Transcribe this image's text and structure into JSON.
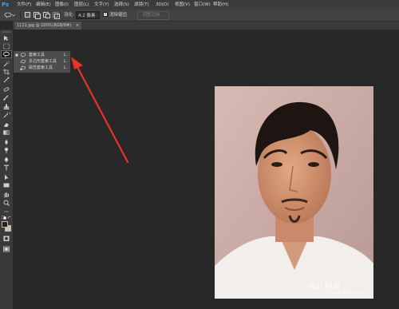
{
  "app": {
    "logo": "Ps"
  },
  "menus": [
    "文件(F)",
    "编辑(E)",
    "图像(I)",
    "图层(L)",
    "文字(Y)",
    "选择(S)",
    "滤镜(T)",
    "3D(D)",
    "视图(V)",
    "窗口(W)",
    "帮助(H)"
  ],
  "options": {
    "feather_label": "羽化:",
    "feather_value": "4.2 像素",
    "antialias_label": "消除锯齿",
    "antialias_checked": true,
    "refine_edge_label": "调整边缘..."
  },
  "document_tab": {
    "title": "1111.jpg @ 100%(RGB/8#)",
    "close": "×"
  },
  "flyout": {
    "items": [
      {
        "label": "套索工具",
        "shortcut": "L",
        "selected": true
      },
      {
        "label": "多边形套索工具",
        "shortcut": "L",
        "selected": false
      },
      {
        "label": "磁性套索工具",
        "shortcut": "L",
        "selected": false
      }
    ]
  },
  "watermark": {
    "text": "Bai 经验",
    "sub": "jingyan.baidu.com"
  },
  "colors": {
    "accent": "#31a8ff",
    "arrow": "#e8322a",
    "foreground": "#2a1f1a",
    "background": "#cfc3ae"
  }
}
